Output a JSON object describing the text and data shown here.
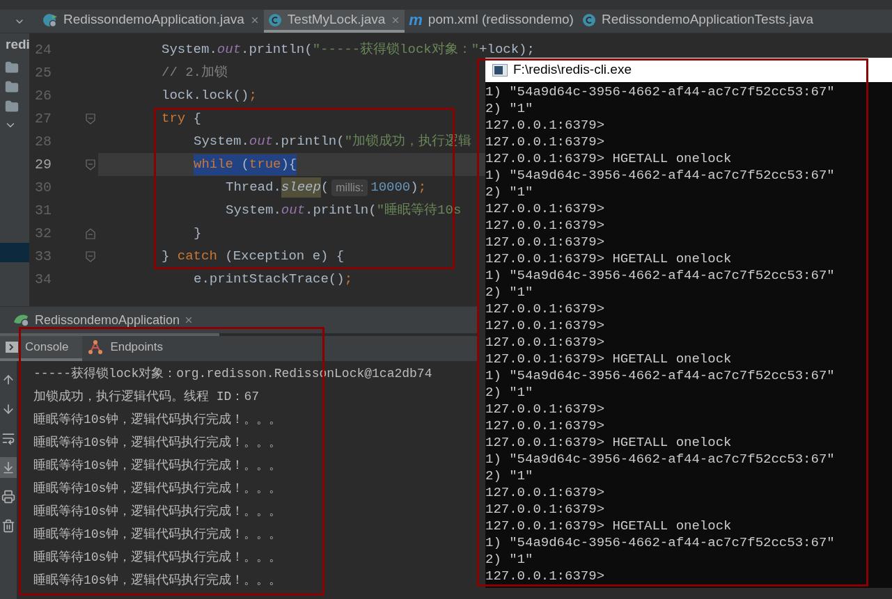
{
  "editor_tabs": [
    {
      "label": "RedissondemoApplication.java",
      "kind": "app",
      "selected": false,
      "closable": true
    },
    {
      "label": "TestMyLock.java",
      "kind": "class",
      "selected": true,
      "closable": true
    },
    {
      "label": "pom.xml (redissondemo)",
      "kind": "maven",
      "badge": "m",
      "selected": false,
      "closable": false
    },
    {
      "label": "RedissondemoApplicationTests.java",
      "kind": "class",
      "selected": false,
      "closable": false
    }
  ],
  "project_panel": {
    "title": "redi"
  },
  "editor": {
    "lines": [
      {
        "number": "24",
        "current": false,
        "selected": false,
        "tokens": [
          {
            "text": "System.",
            "kind": "plain"
          },
          {
            "text": "out",
            "kind": "field"
          },
          {
            "text": ".println(",
            "kind": "plain"
          },
          {
            "text": "\"-----获得锁lock对象：\"",
            "kind": "string"
          },
          {
            "text": "+lock);",
            "kind": "plain"
          }
        ]
      },
      {
        "number": "25",
        "current": false,
        "selected": false,
        "tokens": [
          {
            "text": "// 2.加锁",
            "kind": "comment"
          }
        ]
      },
      {
        "number": "26",
        "current": false,
        "selected": false,
        "tokens": [
          {
            "text": "lock.lock()",
            "kind": "plain"
          },
          {
            "text": ";",
            "kind": "keyword"
          }
        ]
      },
      {
        "number": "27",
        "current": false,
        "selected": false,
        "fold": {
          "kind": "start"
        },
        "tokens": [
          {
            "text": "try",
            "kind": "keyword"
          },
          {
            "text": " {",
            "kind": "plain"
          }
        ],
        "children": [
          {
            "number": "28",
            "current": false,
            "selected": false,
            "tokens": [
              {
                "text": "System.",
                "kind": "plain"
              },
              {
                "text": "out",
                "kind": "field"
              },
              {
                "text": ".println(",
                "kind": "plain"
              },
              {
                "text": "\"加锁成功，执行逻辑",
                "kind": "string"
              }
            ]
          },
          {
            "number": "29",
            "current": true,
            "selected": true,
            "fold": {
              "kind": "start"
            },
            "tokens": [
              {
                "text": "while",
                "kind": "keyword"
              },
              {
                "text": " (",
                "kind": "plain"
              },
              {
                "text": "true",
                "kind": "keyword"
              },
              {
                "text": "){",
                "kind": "plain"
              }
            ],
            "children": [
              {
                "number": "30",
                "current": false,
                "selected": false,
                "tokens": [
                  {
                    "text": "Thread.",
                    "kind": "plain"
                  },
                  {
                    "text": "sleep",
                    "kind": "call"
                  },
                  {
                    "text": "(",
                    "kind": "plain"
                  },
                  {
                    "text": "millis:",
                    "kind": "hint"
                  },
                  {
                    "text": "10000",
                    "kind": "number"
                  },
                  {
                    "text": ")",
                    "kind": "plain"
                  },
                  {
                    "text": ";",
                    "kind": "keyword"
                  }
                ]
              },
              {
                "number": "31",
                "current": false,
                "selected": false,
                "tokens": [
                  {
                    "text": "System.",
                    "kind": "plain"
                  },
                  {
                    "text": "out",
                    "kind": "field"
                  },
                  {
                    "text": ".println(",
                    "kind": "plain"
                  },
                  {
                    "text": "\"睡眠等待10s",
                    "kind": "string"
                  }
                ]
              }
            ]
          },
          {
            "number": "32",
            "current": false,
            "selected": false,
            "fold": {
              "kind": "end"
            },
            "tokens": [
              {
                "text": "}",
                "kind": "plain"
              }
            ]
          }
        ]
      },
      {
        "number": "33",
        "current": false,
        "selected": false,
        "fold": {
          "kind": "start"
        },
        "tokens": [
          {
            "text": "} ",
            "kind": "plain"
          },
          {
            "text": "catch",
            "kind": "keyword"
          },
          {
            "text": " (Exception e) {",
            "kind": "plain"
          }
        ],
        "children": [
          {
            "number": "34",
            "current": false,
            "selected": false,
            "tokens": [
              {
                "text": "e.printStackTrace()",
                "kind": "plain"
              },
              {
                "text": ";",
                "kind": "keyword"
              }
            ]
          }
        ]
      }
    ]
  },
  "run_panel": {
    "tab": "RedissondemoApplication",
    "subtabs": [
      {
        "label": "Console",
        "kind": "console",
        "selected": true
      },
      {
        "label": "Endpoints",
        "kind": "endpoints",
        "selected": false
      }
    ],
    "toolbar": [
      {
        "kind": "up",
        "active": false
      },
      {
        "kind": "down",
        "active": false
      },
      {
        "kind": "wrap",
        "active": false
      },
      {
        "kind": "scroll-end",
        "active": true
      },
      {
        "kind": "print",
        "active": false
      },
      {
        "kind": "trash",
        "active": false
      }
    ],
    "console_lines": [
      "-----获得锁lock对象：org.redisson.RedissonLock@1ca2db74",
      "加锁成功，执行逻辑代码。线程 ID：67",
      "睡眠等待10s钟，逻辑代码执行完成！。。。",
      "睡眠等待10s钟，逻辑代码执行完成！。。。",
      "睡眠等待10s钟，逻辑代码执行完成！。。。",
      "睡眠等待10s钟，逻辑代码执行完成！。。。",
      "睡眠等待10s钟，逻辑代码执行完成！。。。",
      "睡眠等待10s钟，逻辑代码执行完成！。。。",
      "睡眠等待10s钟，逻辑代码执行完成！。。。",
      "睡眠等待10s钟，逻辑代码执行完成！。。。"
    ]
  },
  "terminal": {
    "title": "F:\\redis\\redis-cli.exe",
    "lines": [
      "1) \"54a9d64c-3956-4662-af44-ac7c7f52cc53:67\"",
      "2) \"1\"",
      "127.0.0.1:6379>",
      "127.0.0.1:6379>",
      "127.0.0.1:6379> HGETALL onelock",
      "1) \"54a9d64c-3956-4662-af44-ac7c7f52cc53:67\"",
      "2) \"1\"",
      "127.0.0.1:6379>",
      "127.0.0.1:6379>",
      "127.0.0.1:6379>",
      "127.0.0.1:6379> HGETALL onelock",
      "1) \"54a9d64c-3956-4662-af44-ac7c7f52cc53:67\"",
      "2) \"1\"",
      "127.0.0.1:6379>",
      "127.0.0.1:6379>",
      "127.0.0.1:6379>",
      "127.0.0.1:6379> HGETALL onelock",
      "1) \"54a9d64c-3956-4662-af44-ac7c7f52cc53:67\"",
      "2) \"1\"",
      "127.0.0.1:6379>",
      "127.0.0.1:6379>",
      "127.0.0.1:6379> HGETALL onelock",
      "1) \"54a9d64c-3956-4662-af44-ac7c7f52cc53:67\"",
      "2) \"1\"",
      "127.0.0.1:6379>",
      "127.0.0.1:6379>",
      "127.0.0.1:6379> HGETALL onelock",
      "1) \"54a9d64c-3956-4662-af44-ac7c7f52cc53:67\"",
      "2) \"1\"",
      "127.0.0.1:6379>"
    ]
  }
}
